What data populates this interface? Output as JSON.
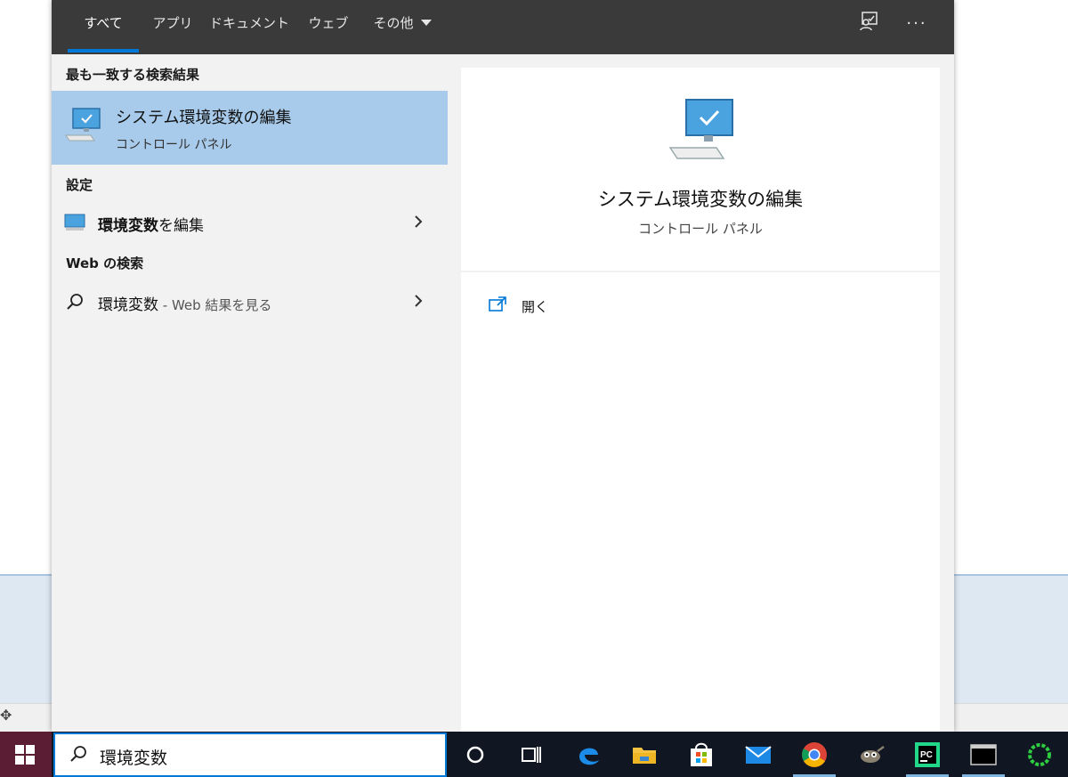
{
  "tabs": [
    {
      "label": "すべて",
      "active": true
    },
    {
      "label": "アプリ"
    },
    {
      "label": "ドキュメント"
    },
    {
      "label": "ウェブ"
    },
    {
      "label": "その他"
    }
  ],
  "toolbar": {
    "feedback_icon": "feedback-icon",
    "more_icon": "ellipsis-icon"
  },
  "sections": {
    "best_match": "最も一致する検索結果",
    "settings": "設定",
    "web": "Web の検索"
  },
  "best_match": {
    "title": "システム環境変数の編集",
    "subtitle": "コントロール パネル",
    "icon": "computer-check-icon"
  },
  "settings_item": {
    "bold": "環境変数",
    "rest": "を編集"
  },
  "web_item": {
    "query": "環境変数",
    "suffix": " - Web 結果を見る"
  },
  "detail": {
    "title": "システム環境変数の編集",
    "subtitle": "コントロール パネル",
    "action_label": "開く"
  },
  "search": {
    "value": "環境変数"
  },
  "colors": {
    "accent": "#0078d7",
    "selection": "#a8cbeb",
    "topbar": "#3a3a3a"
  }
}
